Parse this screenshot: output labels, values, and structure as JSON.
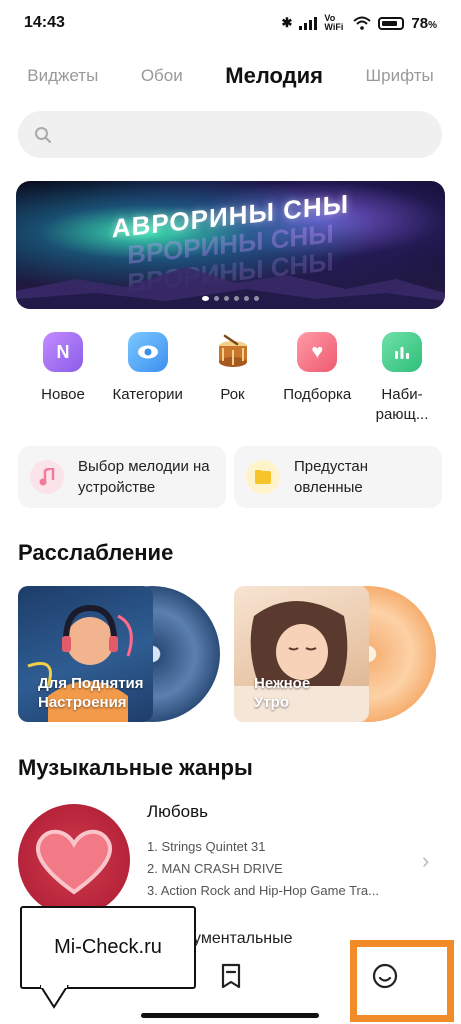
{
  "status_bar": {
    "time": "14:43",
    "network": "Vo WiFi",
    "battery": "78"
  },
  "tabs": [
    {
      "label": "Виджеты",
      "active": false
    },
    {
      "label": "Обои",
      "active": false
    },
    {
      "label": "Мелодия",
      "active": true
    },
    {
      "label": "Шрифты",
      "active": false
    }
  ],
  "search": {
    "placeholder": ""
  },
  "banner": {
    "title": "АВРОРИНЫ СНЫ",
    "echo": "ВРОРИНЫ СНЫ",
    "pages": 6,
    "current_page": 1
  },
  "categories": [
    {
      "label": "Новое",
      "icon": "new-icon",
      "glyph": "N",
      "color": "#a06cf0"
    },
    {
      "label": "Категории",
      "icon": "category-icon",
      "glyph": "",
      "color": "#4aa8f5"
    },
    {
      "label": "Рок",
      "icon": "drum-icon",
      "glyph": "",
      "color": "#d9a14a"
    },
    {
      "label": "Подборка",
      "icon": "heart-icon",
      "glyph": "♥",
      "color": "#f06a7a"
    },
    {
      "label": "Наби-\nрающ...",
      "icon": "chart-icon",
      "glyph": "",
      "color": "#3cc98a"
    }
  ],
  "quick_cards": [
    {
      "label": "Выбор мелодии на\nустройстве",
      "icon": "music-note-icon",
      "color": "#f3c0cc"
    },
    {
      "label": "Предустан\nовленные",
      "icon": "folder-icon",
      "color": "#f7cc3a"
    }
  ],
  "relax": {
    "heading": "Расслабление",
    "albums": [
      {
        "title": "Для Поднятия\nНастроения",
        "accent": "#2d4e7a"
      },
      {
        "title": "Нежное\nУтро",
        "accent": "#f7b37a"
      }
    ]
  },
  "genres": {
    "heading": "Музыкальные жанры",
    "item": {
      "title": "Любовь",
      "tracks": [
        "1. Strings Quintet 31",
        "2. MAN CRASH DRIVE",
        "3. Action Rock and Hip-Hop Game Tra..."
      ]
    },
    "partial_next": "ументальные"
  },
  "watermark": "Mi-Check.ru",
  "colors": {
    "highlight": "#f28c28"
  }
}
